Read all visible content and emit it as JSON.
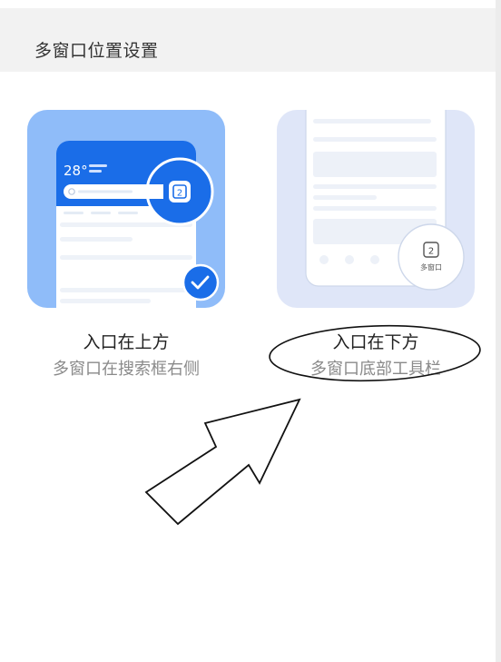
{
  "header": {
    "title": "多窗口位置设置"
  },
  "options": [
    {
      "title": "入口在上方",
      "description": "多窗口在搜索框右侧",
      "selected": true,
      "illustration": {
        "weather": "28°",
        "tab_count": "2"
      }
    },
    {
      "title": "入口在下方",
      "description": "多窗口底部工具栏",
      "selected": false,
      "illustration": {
        "tab_count": "2",
        "tab_label": "多窗口"
      }
    }
  ],
  "colors": {
    "accent": "#1a6de8",
    "card_top_bg": "#8fbcf9",
    "card_bottom_bg": "#dfe6f8",
    "header_bg": "#f2f2f2"
  },
  "icons": {
    "selected_badge": "check-circle-icon",
    "annotation": "arrow-annotation"
  }
}
